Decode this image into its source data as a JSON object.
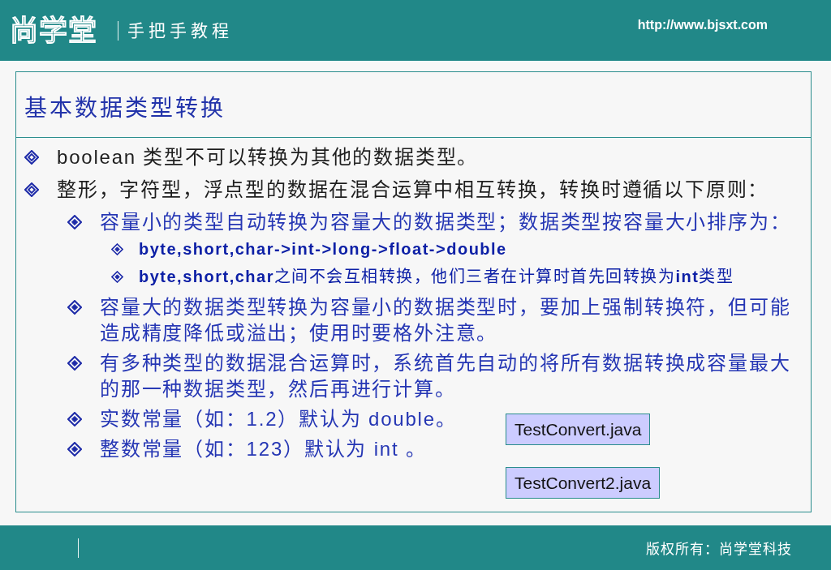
{
  "header": {
    "logo": "尚学堂",
    "subtitle": "手把手教程",
    "url": "http://www.bjsxt.com"
  },
  "slide": {
    "title": "基本数据类型转换",
    "bullets": [
      {
        "text": "boolean 类型不可以转换为其他的数据类型。"
      },
      {
        "text": "整形，字符型，浮点型的数据在混合运算中相互转换，转换时遵循以下原则：",
        "children": [
          {
            "text": "容量小的类型自动转换为容量大的数据类型；数据类型按容量大小排序为：",
            "children": [
              {
                "text": "byte,short,char->int->long->float->double",
                "bold": true
              },
              {
                "text": "**byte,short,char**之间不会互相转换，他们三者在计算时首先回转换为**int**类型",
                "bold": false
              }
            ]
          },
          {
            "text": "容量大的数据类型转换为容量小的数据类型时，要加上强制转换符，但可能造成精度降低或溢出；使用时要格外注意。"
          },
          {
            "text": "有多种类型的数据混合运算时，系统首先自动的将所有数据转换成容量最大的那一种数据类型，然后再进行计算。"
          },
          {
            "text": "实数常量（如：1.2）默认为 double。"
          },
          {
            "text": "整数常量（如：123）默认为 int 。"
          }
        ]
      }
    ],
    "buttons": [
      {
        "label": "TestConvert.java"
      },
      {
        "label": "TestConvert2.java"
      }
    ]
  },
  "footer": {
    "copyright": "版权所有：尚学堂科技"
  }
}
